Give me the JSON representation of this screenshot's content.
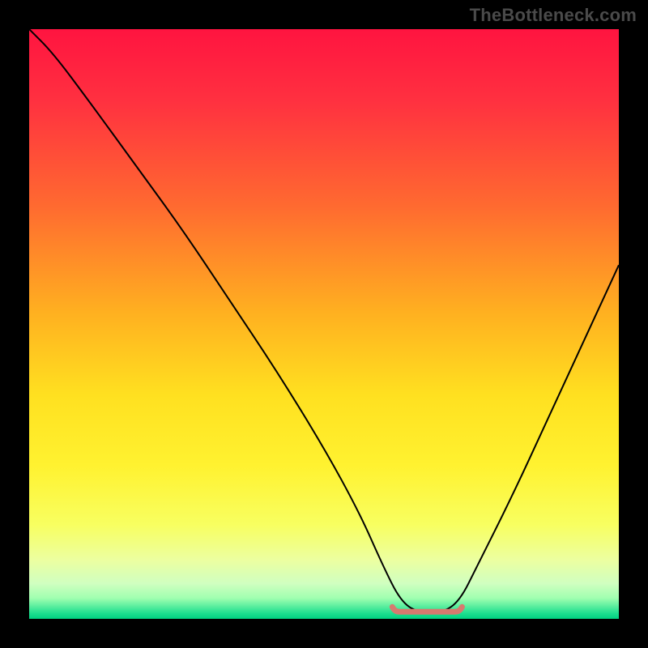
{
  "watermark": "TheBottleneck.com",
  "plot": {
    "margin": 36,
    "size": 728,
    "gradient": {
      "stops": [
        {
          "offset": 0.0,
          "color": "#ff1440"
        },
        {
          "offset": 0.12,
          "color": "#ff3040"
        },
        {
          "offset": 0.3,
          "color": "#ff6a30"
        },
        {
          "offset": 0.48,
          "color": "#ffb020"
        },
        {
          "offset": 0.62,
          "color": "#ffe020"
        },
        {
          "offset": 0.74,
          "color": "#fff230"
        },
        {
          "offset": 0.84,
          "color": "#f8ff60"
        },
        {
          "offset": 0.9,
          "color": "#ecffa0"
        },
        {
          "offset": 0.94,
          "color": "#d0ffc0"
        },
        {
          "offset": 0.965,
          "color": "#a0ffb0"
        },
        {
          "offset": 0.99,
          "color": "#20e090"
        },
        {
          "offset": 1.0,
          "color": "#00d080"
        }
      ]
    },
    "curve": {
      "stroke": "#000000",
      "width": 2,
      "fill": "none"
    },
    "optimal_marker": {
      "stroke": "#d77a6f",
      "width": 7,
      "linecap": "round"
    }
  },
  "chart_data": {
    "type": "line",
    "title": "",
    "xlabel": "",
    "ylabel": "",
    "xlim": [
      0,
      100
    ],
    "ylim": [
      0,
      100
    ],
    "grid": false,
    "legend": false,
    "description": "Bottleneck curve: high on left, descends to flat minimum near x≈62–72, rises again toward right edge; vertical gradient from red (top) to green (bottom).",
    "series": [
      {
        "name": "bottleneck-curve",
        "x": [
          0,
          4,
          10,
          18,
          26,
          34,
          42,
          50,
          56,
          60,
          63,
          66,
          70,
          73,
          76,
          82,
          88,
          94,
          100
        ],
        "y": [
          100,
          96,
          88,
          77,
          66,
          54,
          42,
          29,
          18,
          9,
          3,
          1,
          1,
          3,
          9,
          21,
          34,
          47,
          60
        ]
      }
    ],
    "optimal_range": {
      "x_start": 62,
      "x_end": 73,
      "y": 1.2
    }
  }
}
